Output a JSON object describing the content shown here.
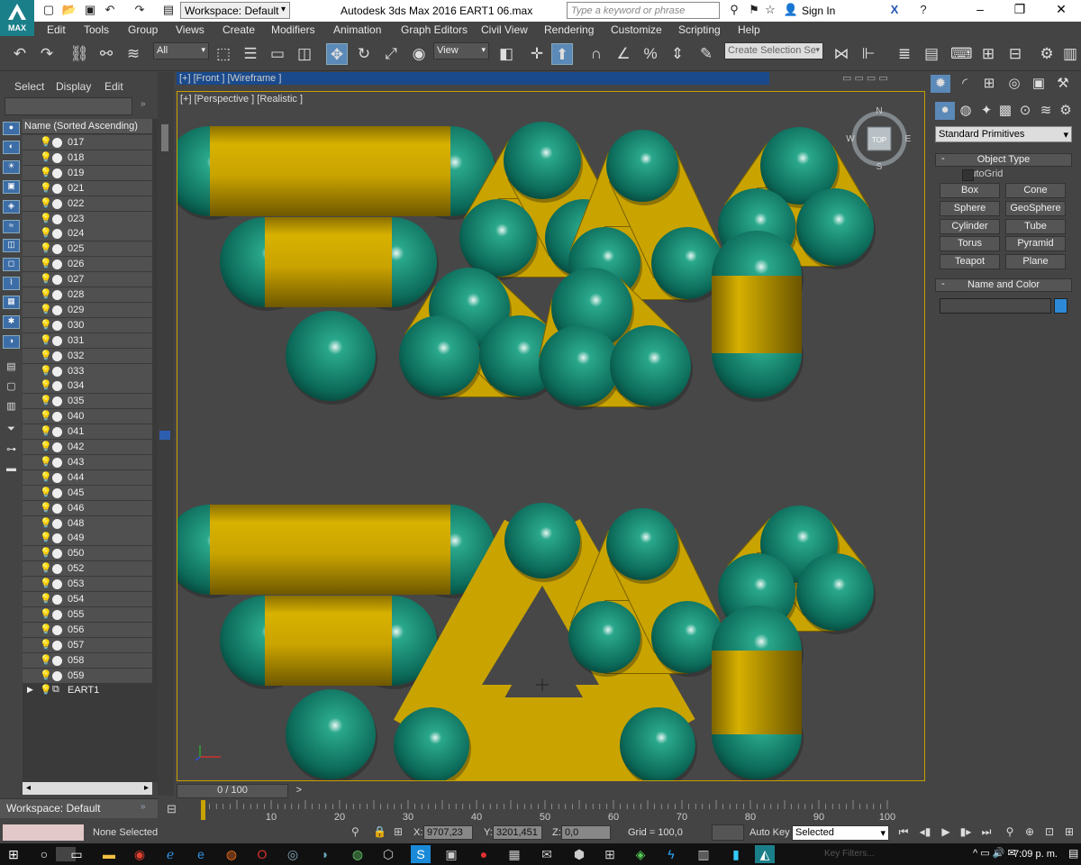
{
  "titlebar": {
    "logo_text": "MAX",
    "workspace": "Workspace: Default",
    "title": "Autodesk 3ds Max 2016     EART1 06.max",
    "search_placeholder": "Type a keyword or phrase",
    "signin": "Sign In"
  },
  "menu": [
    "Edit",
    "Tools",
    "Group",
    "Views",
    "Create",
    "Modifiers",
    "Animation",
    "Graph Editors",
    "Civil View",
    "Rendering",
    "Customize",
    "Scripting",
    "Help"
  ],
  "toolbar": {
    "filter": "All",
    "refcoord": "View",
    "selection_set_placeholder": "Create Selection Se"
  },
  "scene_explorer": {
    "tabs": [
      "Select",
      "Display",
      "Edit"
    ],
    "header": "Name (Sorted Ascending)",
    "items": [
      "017",
      "018",
      "019",
      "021",
      "022",
      "023",
      "024",
      "025",
      "026",
      "027",
      "028",
      "029",
      "030",
      "031",
      "032",
      "033",
      "034",
      "035",
      "040",
      "041",
      "042",
      "043",
      "044",
      "045",
      "046",
      "048",
      "049",
      "050",
      "052",
      "053",
      "054",
      "055",
      "056",
      "057",
      "058",
      "059"
    ],
    "group": "EART1",
    "workspace": "Workspace: Default"
  },
  "viewport": {
    "front_label": "[+] [Front ] [Wireframe ]",
    "label": "[+] [Perspective ] [Realistic ]",
    "cube_face": "TOP",
    "compass": {
      "n": "N",
      "s": "S",
      "e": "E",
      "w": "W"
    },
    "colors": {
      "yellow": "#c9a300",
      "teal": "#0f7a68",
      "background": "#474747"
    }
  },
  "command_panel": {
    "category": "Standard Primitives",
    "object_type_title": "Object Type",
    "autogrid": "AutoGrid",
    "buttons": [
      "Box",
      "Cone",
      "Sphere",
      "GeoSphere",
      "Cylinder",
      "Tube",
      "Torus",
      "Pyramid",
      "Teapot",
      "Plane"
    ],
    "name_color_title": "Name and Color",
    "object_color": "#2d8ad8"
  },
  "timeline": {
    "time": "0 / 100",
    "ticks": [
      "10",
      "20",
      "30",
      "40",
      "50",
      "60",
      "70",
      "80",
      "90",
      "100"
    ]
  },
  "status": {
    "selection": "None Selected",
    "x_label": "X:",
    "x": "9707,23",
    "y_label": "Y:",
    "y": "3201,451",
    "z_label": "Z:",
    "z": "0,0",
    "grid": "Grid = 100,0",
    "autokey": "Auto Key",
    "selected": "Selected",
    "key_filters": "Key Filters..."
  },
  "taskbar": {
    "clock": "7:09 p. m."
  }
}
